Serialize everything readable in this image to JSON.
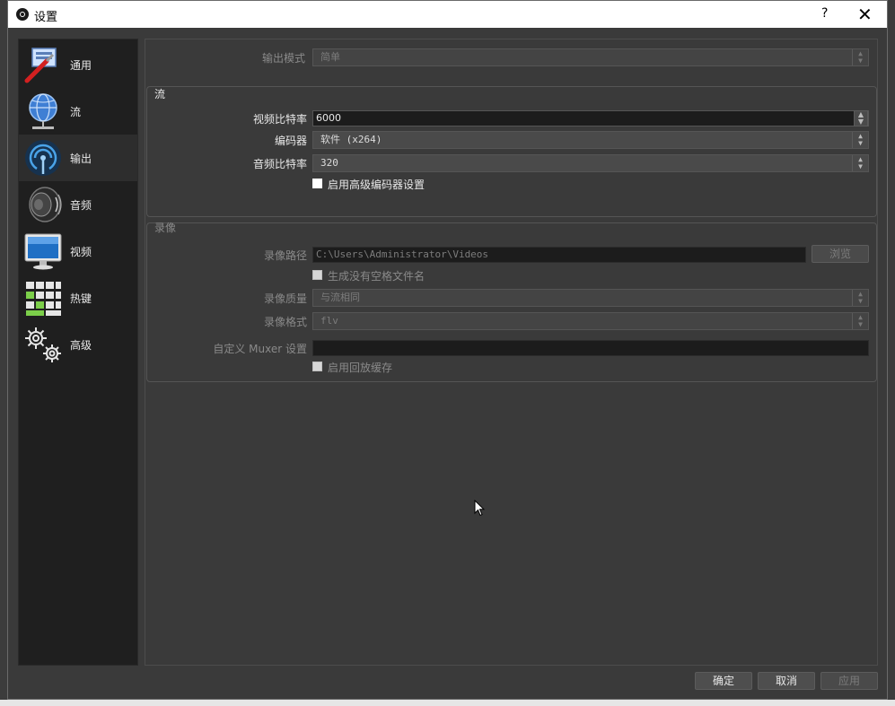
{
  "window": {
    "title": "设置",
    "help_label": "?",
    "close_label": "✕"
  },
  "sidebar": {
    "items": [
      {
        "label": "通用",
        "icon": "general-icon"
      },
      {
        "label": "流",
        "icon": "globe-stream-icon"
      },
      {
        "label": "输出",
        "icon": "antenna-output-icon",
        "active": true
      },
      {
        "label": "音频",
        "icon": "speaker-icon"
      },
      {
        "label": "视频",
        "icon": "monitor-icon"
      },
      {
        "label": "热键",
        "icon": "keyboard-icon"
      },
      {
        "label": "高级",
        "icon": "gears-icon"
      }
    ]
  },
  "output": {
    "mode_label": "输出模式",
    "mode_value": "简单",
    "stream": {
      "title": "流",
      "video_bitrate_label": "视频比特率",
      "video_bitrate_value": "6000",
      "encoder_label": "编码器",
      "encoder_value": "软件 (x264)",
      "audio_bitrate_label": "音频比特率",
      "audio_bitrate_value": "320",
      "advanced_encoder_label": "启用高级编码器设置",
      "advanced_encoder_checked": false
    },
    "recording": {
      "title": "录像",
      "path_label": "录像路径",
      "path_value": "C:\\Users\\Administrator\\Videos",
      "browse_label": "浏览",
      "no_space_label": "生成没有空格文件名",
      "quality_label": "录像质量",
      "quality_value": "与流相同",
      "format_label": "录像格式",
      "format_value": "flv",
      "muxer_label": "自定义 Muxer 设置",
      "muxer_value": "",
      "replay_buffer_label": "启用回放缓存"
    }
  },
  "buttons": {
    "ok": "确定",
    "cancel": "取消",
    "apply": "应用"
  },
  "colors": {
    "window_bg": "#3a3a3a",
    "sidebar_bg": "#1f1f1f",
    "titlebar_bg": "#ffffff"
  }
}
